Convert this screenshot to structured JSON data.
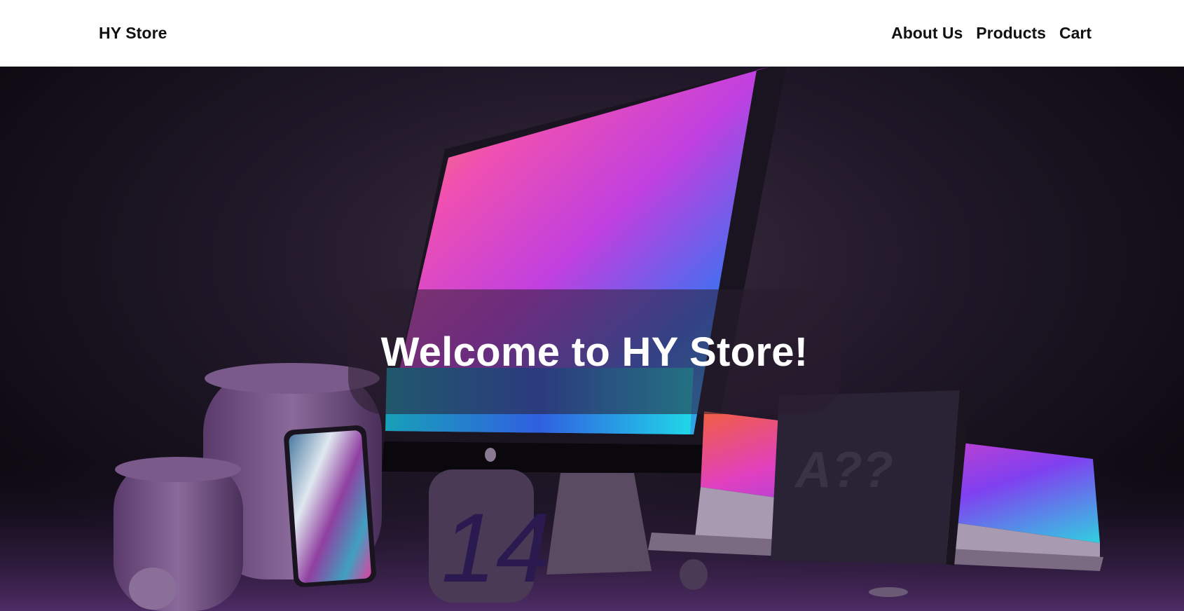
{
  "nav": {
    "brand": "HY Store",
    "links": [
      {
        "label": "About Us"
      },
      {
        "label": "Products"
      },
      {
        "label": "Cart"
      }
    ]
  },
  "hero": {
    "title": "Welcome to HY Store!",
    "image_alt": "Apple product lineup"
  }
}
